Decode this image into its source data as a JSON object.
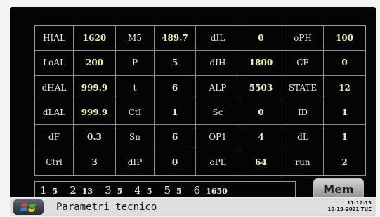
{
  "table": {
    "rows": [
      [
        "HIAL",
        "1620",
        "M5",
        "489.7",
        "dIL",
        "0",
        "oPH",
        "100"
      ],
      [
        "LoAL",
        "200",
        "P",
        "5",
        "dIH",
        "1800",
        "CF",
        "0"
      ],
      [
        "dHAL",
        "999.9",
        "t",
        "6",
        "ALP",
        "5503",
        "STATE",
        "12"
      ],
      [
        "dLAL",
        "999.9",
        "CtI",
        "1",
        "Sc",
        "0",
        "ID",
        "1"
      ],
      [
        "dF",
        "0.3",
        "Sn",
        "6",
        "OP1",
        "4",
        "dL",
        "1"
      ],
      [
        "Ctrl",
        "3",
        "dIP",
        "0",
        "oPL",
        "64",
        "run",
        "2"
      ]
    ]
  },
  "status": {
    "items": [
      {
        "n": "1",
        "v": "5"
      },
      {
        "n": "2",
        "v": "13"
      },
      {
        "n": "3",
        "v": "5"
      },
      {
        "n": "4",
        "v": "5"
      },
      {
        "n": "5",
        "v": "5"
      },
      {
        "n": "6",
        "v": "1650"
      }
    ]
  },
  "buttons": {
    "mem": "Mem"
  },
  "taskbar": {
    "title": "Parametri tecnico",
    "time": "11:12:13",
    "date": "10-19-2021 TUE",
    "start_icon": "windows-logo-icon"
  },
  "colors": {
    "value": "#f2f2a6",
    "label": "#e8e8e8",
    "screen": "#040404"
  }
}
